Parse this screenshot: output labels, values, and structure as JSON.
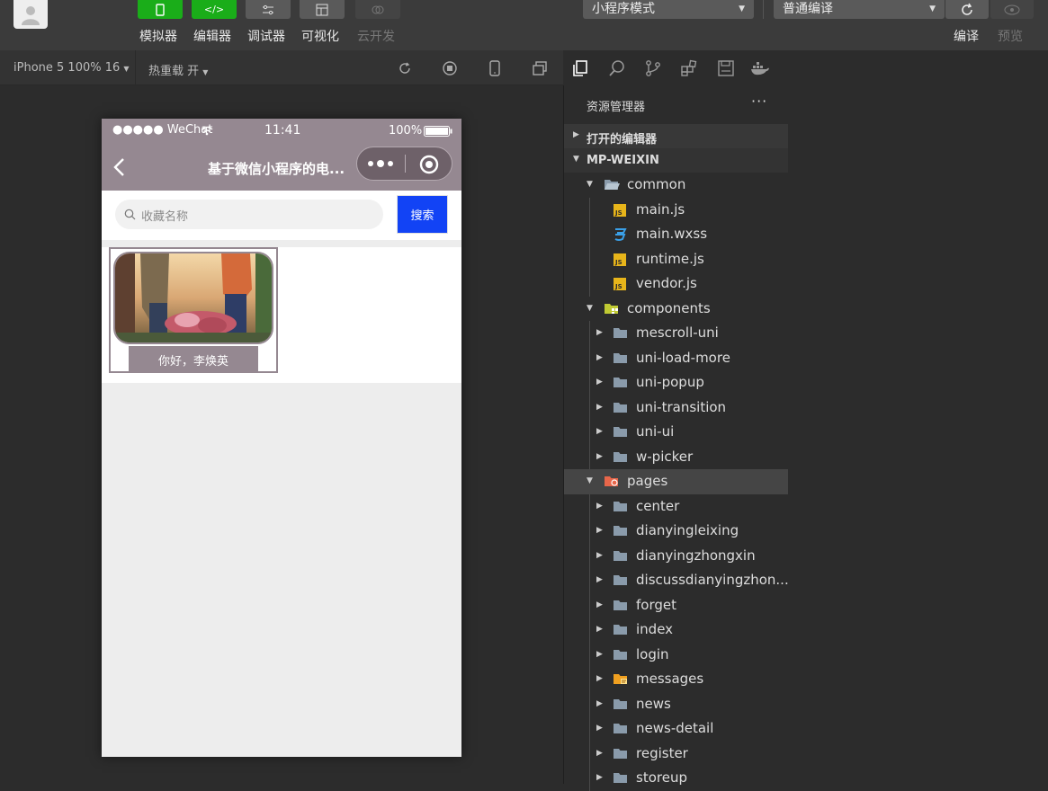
{
  "toolbar": {
    "buttons": [
      {
        "label": "模拟器",
        "color": "#1aad19"
      },
      {
        "label": "编辑器",
        "color": "#1aad19"
      },
      {
        "label": "调试器",
        "color": "#5a5a5a"
      },
      {
        "label": "可视化",
        "color": "#5a5a5a"
      },
      {
        "label": "云开发",
        "color": "#444444"
      }
    ],
    "mode_select": "小程序模式",
    "compile_select": "普通编译",
    "compile_label": "编译",
    "preview_label": "预览"
  },
  "subbar": {
    "device": "iPhone 5 100% 16",
    "hot_reload": "热重载 开"
  },
  "phone": {
    "status": {
      "carrier": "●●●●● WeChat",
      "time": "11:41",
      "battery": "100%"
    },
    "nav_title": "基于微信小程序的电...",
    "search_placeholder": "收藏名称",
    "search_button": "搜索",
    "items": [
      {
        "name": "你好，李焕英"
      }
    ],
    "theme_color": "#958891",
    "button_color": "#1243f5"
  },
  "explorer": {
    "title": "资源管理器",
    "open_editors": "打开的编辑器",
    "root": "MP-WEIXIN",
    "tree": [
      {
        "name": "common",
        "type": "folder-open",
        "depth": 1,
        "expanded": true
      },
      {
        "name": "main.js",
        "type": "js",
        "depth": 2
      },
      {
        "name": "main.wxss",
        "type": "css",
        "depth": 2
      },
      {
        "name": "runtime.js",
        "type": "js",
        "depth": 2
      },
      {
        "name": "vendor.js",
        "type": "js",
        "depth": 2
      },
      {
        "name": "components",
        "type": "folder-components",
        "depth": 1,
        "expanded": true
      },
      {
        "name": "mescroll-uni",
        "type": "folder",
        "depth": 2
      },
      {
        "name": "uni-load-more",
        "type": "folder",
        "depth": 2
      },
      {
        "name": "uni-popup",
        "type": "folder",
        "depth": 2
      },
      {
        "name": "uni-transition",
        "type": "folder",
        "depth": 2
      },
      {
        "name": "uni-ui",
        "type": "folder",
        "depth": 2
      },
      {
        "name": "w-picker",
        "type": "folder",
        "depth": 2
      },
      {
        "name": "pages",
        "type": "folder-pages",
        "depth": 1,
        "expanded": true,
        "selected": true
      },
      {
        "name": "center",
        "type": "folder",
        "depth": 2
      },
      {
        "name": "dianyingleixing",
        "type": "folder",
        "depth": 2
      },
      {
        "name": "dianyingzhongxin",
        "type": "folder",
        "depth": 2
      },
      {
        "name": "discussdianyingzhon...",
        "type": "folder",
        "depth": 2
      },
      {
        "name": "forget",
        "type": "folder",
        "depth": 2
      },
      {
        "name": "index",
        "type": "folder",
        "depth": 2
      },
      {
        "name": "login",
        "type": "folder",
        "depth": 2
      },
      {
        "name": "messages",
        "type": "folder-messages",
        "depth": 2
      },
      {
        "name": "news",
        "type": "folder",
        "depth": 2
      },
      {
        "name": "news-detail",
        "type": "folder",
        "depth": 2
      },
      {
        "name": "register",
        "type": "folder",
        "depth": 2
      },
      {
        "name": "storeup",
        "type": "folder",
        "depth": 2
      }
    ]
  }
}
